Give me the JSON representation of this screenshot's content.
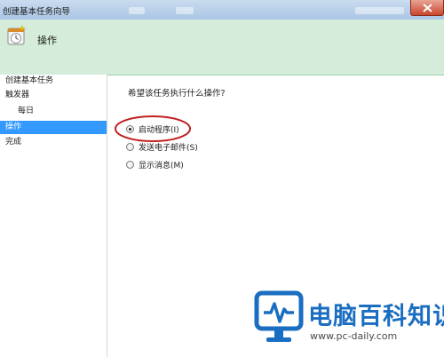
{
  "window": {
    "title": "创建基本任务向导",
    "close_icon": "close-icon"
  },
  "header": {
    "icon": "task-clock-icon",
    "title": "操作",
    "background": "#d4ecd9"
  },
  "nav": {
    "items": [
      {
        "label": "创建基本任务",
        "level": 0,
        "selected": false
      },
      {
        "label": "触发器",
        "level": 0,
        "selected": false
      },
      {
        "label": "每日",
        "level": 1,
        "selected": false
      },
      {
        "label": "操作",
        "level": 0,
        "selected": true
      },
      {
        "label": "完成",
        "level": 0,
        "selected": false
      }
    ],
    "selected_color": "#3399ff"
  },
  "content": {
    "question": "希望该任务执行什么操作?",
    "options": [
      {
        "label": "启动程序(I)",
        "checked": true
      },
      {
        "label": "发送电子邮件(S)",
        "checked": false
      },
      {
        "label": "显示消息(M)",
        "checked": false
      }
    ],
    "annotation_color": "#c01f1f"
  },
  "watermark": {
    "brand": "电脑百科知识",
    "url": "www.pc-daily.com",
    "logo": "monitor-pulse-icon",
    "color": "#1a6ec1"
  }
}
